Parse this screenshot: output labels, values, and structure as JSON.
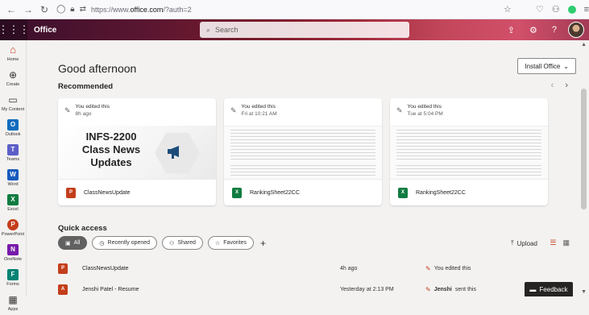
{
  "browser": {
    "url_prefix": "https://www.",
    "url_domain": "office.com",
    "url_suffix": "/?auth=2"
  },
  "header": {
    "brand": "Office",
    "search_placeholder": "Search"
  },
  "rail": [
    {
      "label": "Home",
      "icon": "home-icon"
    },
    {
      "label": "Create",
      "icon": "plus-circle-icon"
    },
    {
      "label": "My Content",
      "icon": "folder-icon"
    },
    {
      "label": "Outlook",
      "icon": "outlook-icon"
    },
    {
      "label": "Teams",
      "icon": "teams-icon"
    },
    {
      "label": "Word",
      "icon": "word-icon"
    },
    {
      "label": "Excel",
      "icon": "excel-icon"
    },
    {
      "label": "PowerPoint",
      "icon": "powerpoint-icon"
    },
    {
      "label": "OneNote",
      "icon": "onenote-icon"
    },
    {
      "label": "Forms",
      "icon": "forms-icon"
    },
    {
      "label": "Apps",
      "icon": "apps-icon"
    }
  ],
  "main": {
    "greeting": "Good afternoon",
    "install_label": "Install Office",
    "recommended_title": "Recommended",
    "cards": [
      {
        "action": "You edited this",
        "when": "8h ago",
        "file": "ClassNewsUpdate",
        "type": "ppt",
        "thumb_title_1": "INFS-2200",
        "thumb_title_2": "Class News",
        "thumb_title_3": "Updates"
      },
      {
        "action": "You edited this",
        "when": "Fri at 10:21 AM",
        "file": "RankingSheet22CC",
        "type": "xlsx"
      },
      {
        "action": "You edited this",
        "when": "Tue at 5:04 PM",
        "file": "RankingSheet22CC",
        "type": "xlsx"
      }
    ],
    "quick_access_title": "Quick access",
    "filters": {
      "all": "All",
      "recent": "Recently opened",
      "shared": "Shared",
      "favorites": "Favorites"
    },
    "upload_label": "Upload",
    "files": [
      {
        "name": "ClassNewsUpdate",
        "time": "4h ago",
        "activity": "You edited this",
        "actor": "",
        "type": "ppt"
      },
      {
        "name": "Jenshi Patel - Resume",
        "time": "Yesterday at 2:13 PM",
        "activity": "sent this",
        "actor": "Jenshi",
        "type": "pdf"
      }
    ]
  },
  "feedback_label": "Feedback",
  "colors": {
    "accent": "#c43e1c",
    "excel": "#107c41",
    "word": "#185abd",
    "outlook": "#0f6cbd",
    "teams": "#5b5fc7"
  }
}
